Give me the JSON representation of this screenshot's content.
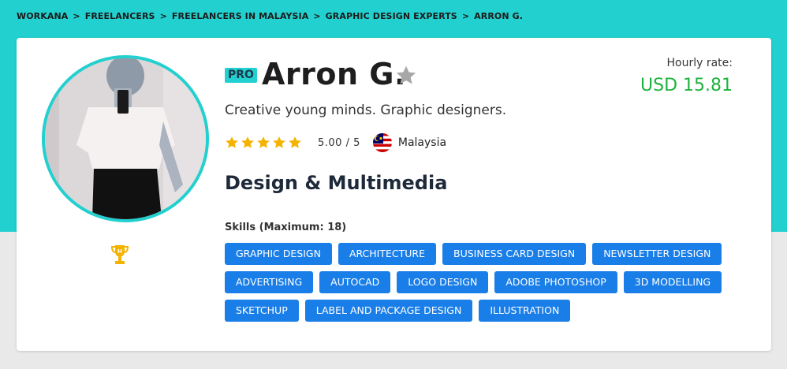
{
  "breadcrumb": [
    "WORKANA",
    "FREELANCERS",
    "FREELANCERS IN MALAYSIA",
    "GRAPHIC DESIGN EXPERTS",
    "ARRON G."
  ],
  "breadcrumb_separator": ">",
  "profile": {
    "badge": "PRO",
    "name": "Arron G.",
    "tagline": "Creative young minds. Graphic designers.",
    "rating": "5.00 / 5",
    "stars": 5,
    "country": "Malaysia",
    "category": "Design & Multimedia",
    "hourly_rate_label": "Hourly rate:",
    "hourly_rate_value": "USD 15.81"
  },
  "skills": {
    "title": "Skills (Maximum: 18)",
    "items": [
      "GRAPHIC DESIGN",
      "ARCHITECTURE",
      "BUSINESS CARD DESIGN",
      "NEWSLETTER DESIGN",
      "ADVERTISING",
      "AUTOCAD",
      "LOGO DESIGN",
      "ADOBE PHOTOSHOP",
      "3D MODELLING",
      "SKETCHUP",
      "LABEL AND PACKAGE DESIGN",
      "ILLUSTRATION"
    ]
  },
  "colors": {
    "teal": "#22d0cf",
    "skill_blue": "#1a7ee8",
    "rate_green": "#1cb33c",
    "star_gold": "#f5b301"
  },
  "icons": [
    "trophy-icon",
    "favorite-star-icon",
    "rating-star-icon",
    "malaysia-flag-icon"
  ]
}
